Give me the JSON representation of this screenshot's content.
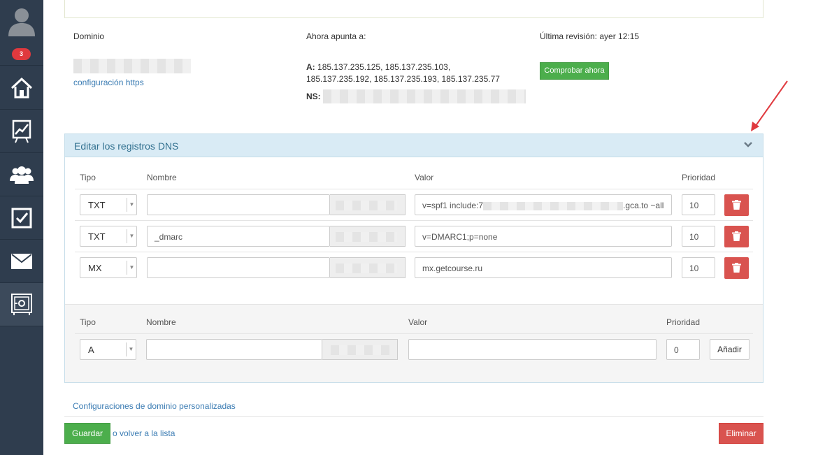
{
  "sidebar": {
    "notifications_count": "3",
    "items": [
      "home-icon",
      "chart-icon",
      "users-icon",
      "tasks-icon",
      "mail-icon",
      "safe-icon"
    ]
  },
  "domain": {
    "label": "Dominio",
    "https_link": "configuración https",
    "points_label": "Ahora apunta a:",
    "a_label": "A:",
    "a_records": "185.137.235.125, 185.137.235.103, 185.137.235.192, 185.137.235.193, 185.137.235.77",
    "ns_label": "NS:",
    "revision": "Última revisión: ayer 12:15",
    "check_button": "Comprobar ahora"
  },
  "dns": {
    "title": "Editar los registros DNS",
    "headers": {
      "type": "Tipo",
      "name": "Nombre",
      "value": "Valor",
      "priority": "Prioridad"
    },
    "records": [
      {
        "type": "TXT",
        "name": "",
        "value_prefix": "v=spf1 include:7",
        "value_suffix": ".gca.to ~all",
        "priority": "10"
      },
      {
        "type": "TXT",
        "name": "_dmarc",
        "value_prefix": "v=DMARC1;p=none",
        "value_suffix": "",
        "priority": "10"
      },
      {
        "type": "MX",
        "name": "",
        "value_prefix": "mx.getcourse.ru",
        "value_suffix": "",
        "priority": "10"
      }
    ],
    "new_record": {
      "headers": {
        "type": "Tipo",
        "name": "Nombre",
        "value": "Valor",
        "priority": "Prioridad"
      },
      "type": "A",
      "name": "",
      "value": "",
      "priority": "0",
      "add_button": "Añadir"
    }
  },
  "footer": {
    "custom_link": "Configuraciones de dominio personalizadas",
    "save_button": "Guardar",
    "back_text": "o volver a la lista",
    "delete_button": "Eliminar"
  },
  "colors": {
    "sidebar": "#2f3d4e",
    "green": "#4cae4c",
    "red": "#d9534f",
    "link": "#3b7cb3",
    "arrow": "#e0393e"
  }
}
